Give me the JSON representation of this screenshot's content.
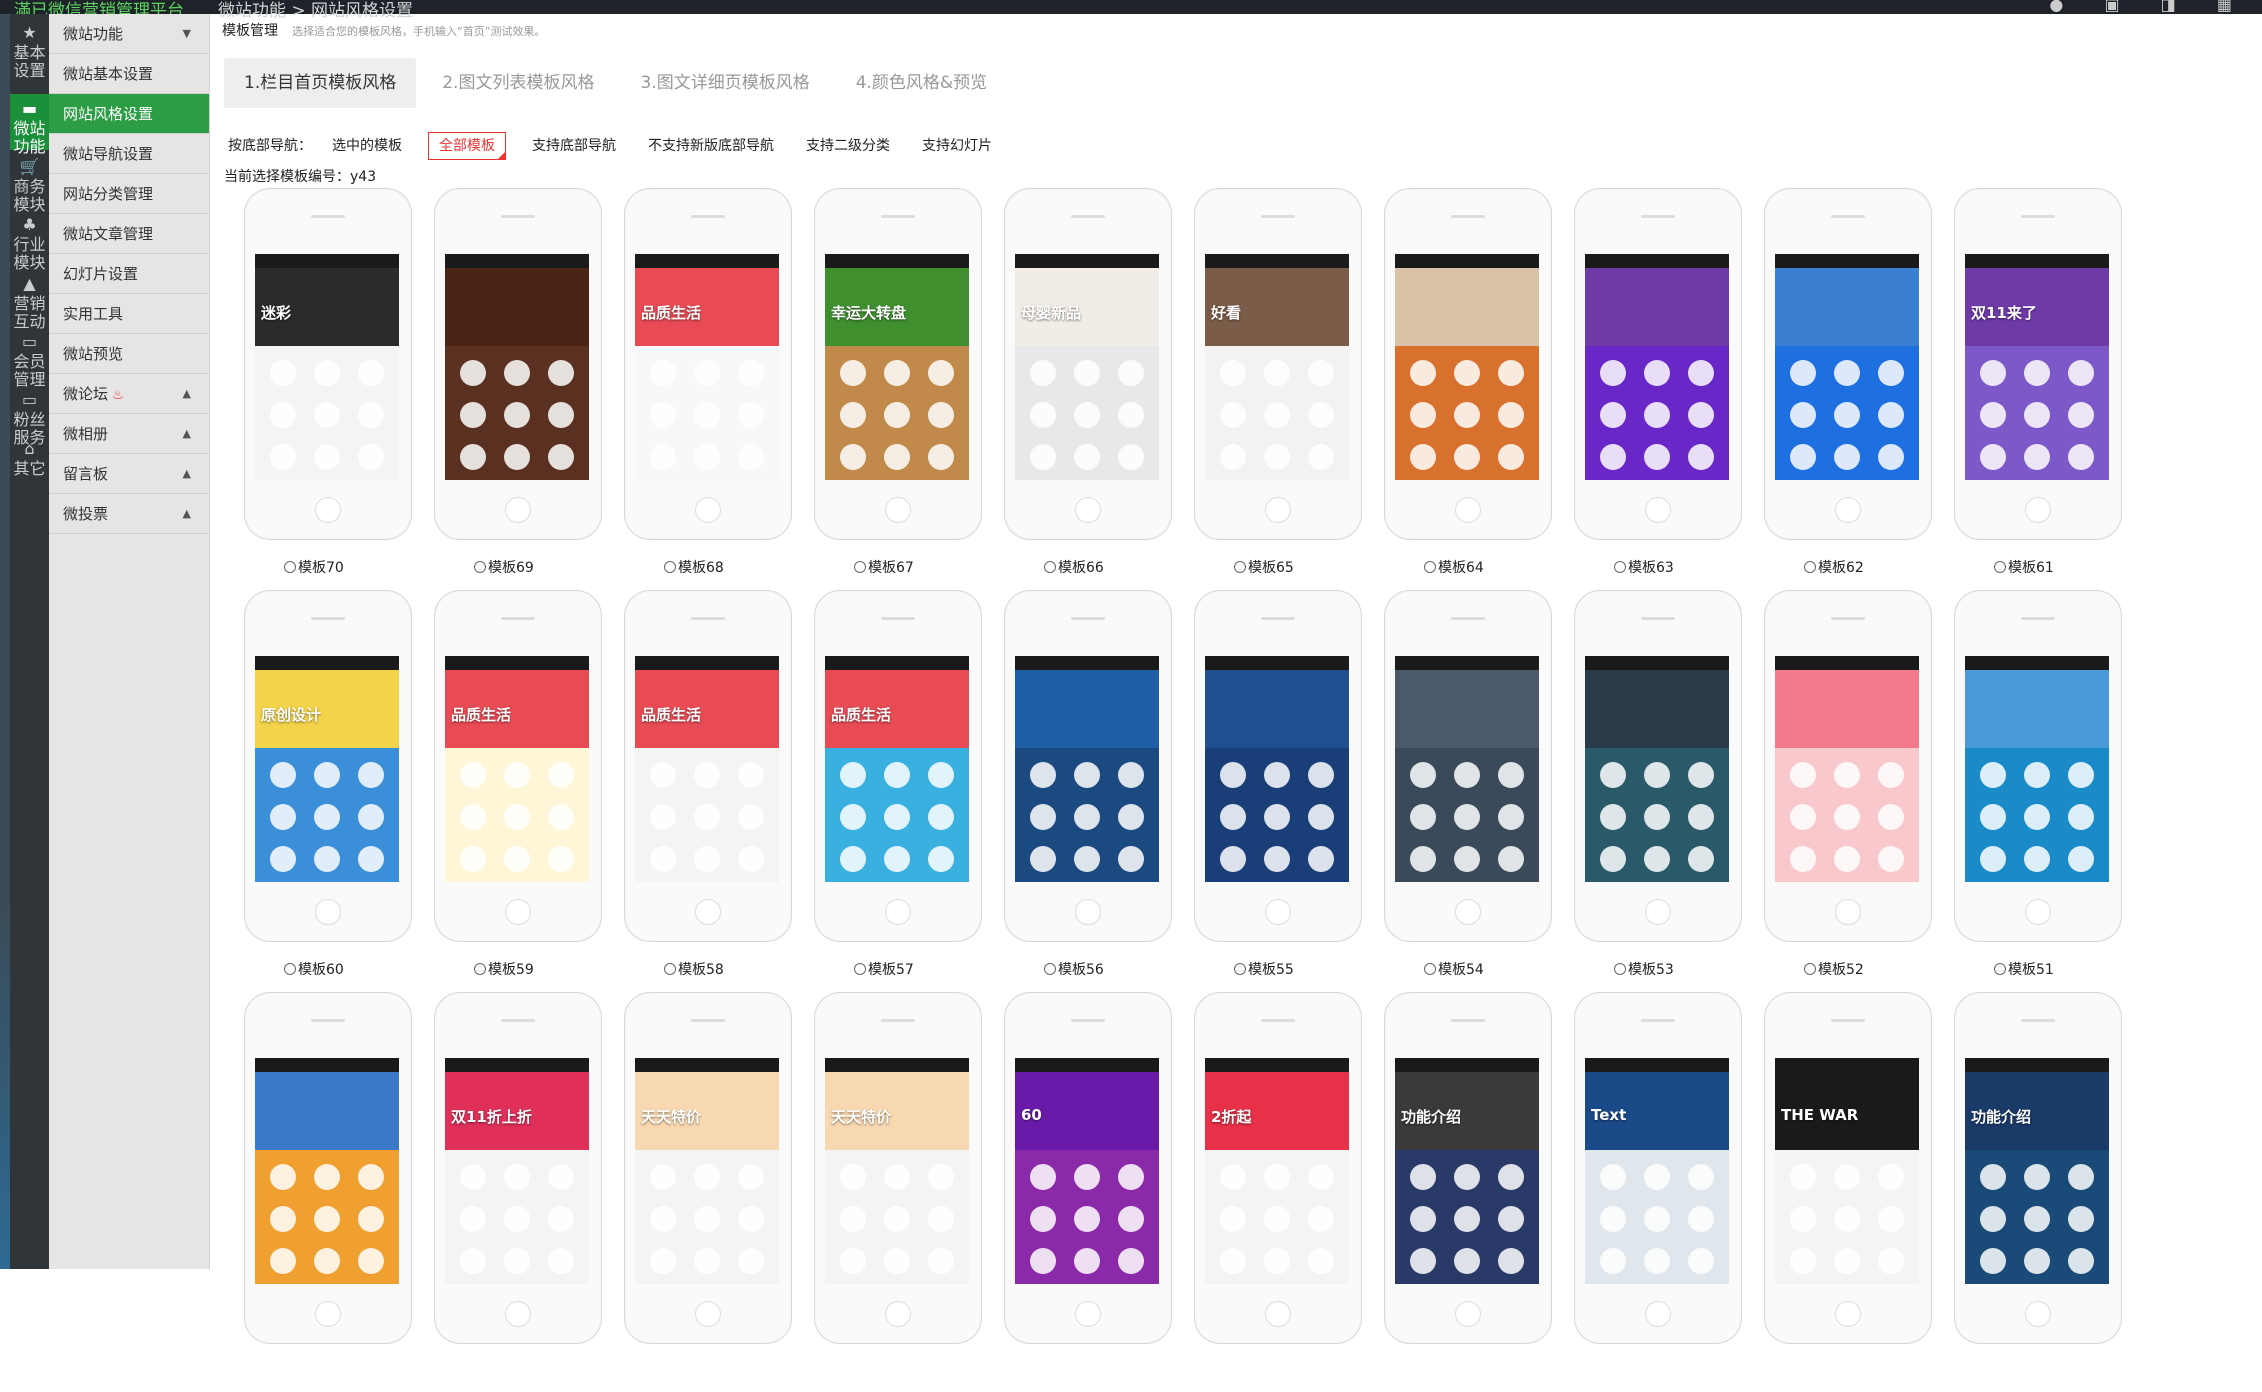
{
  "topbar": {
    "brand": "滿已微信营销管理平台",
    "crumb": "微站功能 > 网站风格设置",
    "right_icons": "● ▣ ◨ ▦"
  },
  "iconbar": [
    {
      "name": "基本设置",
      "icon": "★"
    },
    {
      "name": "微站功能",
      "icon": "▬",
      "active": true
    },
    {
      "name": "商务模块",
      "icon": "🛒"
    },
    {
      "name": "行业模块",
      "icon": "♣"
    },
    {
      "name": "营销互动",
      "icon": "▲"
    },
    {
      "name": "会员管理",
      "icon": "▭"
    },
    {
      "name": "粉丝服务",
      "icon": "▭"
    },
    {
      "name": "其它",
      "icon": "⌂"
    }
  ],
  "menu": [
    {
      "label": "微站功能",
      "arrow": "▼"
    },
    {
      "label": "微站基本设置"
    },
    {
      "label": "网站风格设置",
      "active": true
    },
    {
      "label": "微站导航设置"
    },
    {
      "label": "网站分类管理"
    },
    {
      "label": "微站文章管理"
    },
    {
      "label": "幻灯片设置"
    },
    {
      "label": "实用工具"
    },
    {
      "label": "微站预览"
    },
    {
      "label": "微论坛",
      "arrow": "▲",
      "hot": true
    },
    {
      "label": "微相册",
      "arrow": "▲"
    },
    {
      "label": "留言板",
      "arrow": "▲"
    },
    {
      "label": "微投票",
      "arrow": "▲"
    }
  ],
  "page": {
    "title": "模板管理",
    "hint": "选择适合您的模板风格，手机输入“首页”测试效果。"
  },
  "tabs": [
    "1.栏目首页模板风格",
    "2.图文列表模板风格",
    "3.图文详细页模板风格",
    "4.颜色风格&预览"
  ],
  "filters": {
    "label": "按底部导航：",
    "options": [
      "选中的模板",
      "全部模板",
      "支持底部导航",
      "不支持新版底部导航",
      "支持二级分类",
      "支持幻灯片"
    ],
    "selected": 1
  },
  "current": "当前选择模板编号：y43",
  "templates": [
    {
      "label": "模板70",
      "banner": "#2b2b2b",
      "body": "#f4f4f4",
      "btxt": "迷彩"
    },
    {
      "label": "模板69",
      "banner": "#4a2414",
      "body": "#5a3020",
      "btxt": ""
    },
    {
      "label": "模板68",
      "banner": "#e94b55",
      "body": "#f8f8f8",
      "btxt": "品质生活"
    },
    {
      "label": "模板67",
      "banner": "#3f8f2f",
      "body": "#c28a4a",
      "btxt": "幸运大转盘"
    },
    {
      "label": "模板66",
      "banner": "#f2ece6",
      "body": "#e8e8e8",
      "btxt": "母婴新品"
    },
    {
      "label": "模板65",
      "banner": "#7a5c48",
      "body": "#f2f2f2",
      "btxt": "好看"
    },
    {
      "label": "模板64",
      "banner": "#d9c2a8",
      "body": "#d8702e",
      "btxt": ""
    },
    {
      "label": "模板63",
      "banner": "#6e3aa8",
      "body": "#6a27c8",
      "btxt": ""
    },
    {
      "label": "模板62",
      "banner": "#3a7fd0",
      "body": "#1e6fe0",
      "btxt": ""
    },
    {
      "label": "模板61",
      "banner": "#6e3aa8",
      "body": "#7d58c8",
      "btxt": "双11来了"
    },
    {
      "label": "模板60",
      "banner": "#f3d34a",
      "body": "#3a8fd8",
      "btxt": "原创设计"
    },
    {
      "label": "模板59",
      "banner": "#e94b55",
      "body": "#fff6d8",
      "btxt": "品质生活"
    },
    {
      "label": "模板58",
      "banner": "#e94b55",
      "body": "#f4f4f4",
      "btxt": "品质生活"
    },
    {
      "label": "模板57",
      "banner": "#e94b55",
      "body": "#3ab0e0",
      "btxt": "品质生活"
    },
    {
      "label": "模板56",
      "banner": "#1e5fa8",
      "body": "#1b4a80",
      "btxt": ""
    },
    {
      "label": "模板55",
      "banner": "#1f4f8f",
      "body": "#1a3f78",
      "btxt": ""
    },
    {
      "label": "模板54",
      "banner": "#4a5a6a",
      "body": "#3a4a5a",
      "btxt": ""
    },
    {
      "label": "模板53",
      "banner": "#2a3a48",
      "body": "#2a5a6a",
      "btxt": ""
    },
    {
      "label": "模板52",
      "banner": "#f27a8a",
      "body": "#f8c8cc",
      "btxt": ""
    },
    {
      "label": "模板51",
      "banner": "#4a9ad8",
      "body": "#1a8ac8",
      "btxt": ""
    },
    {
      "label": "",
      "banner": "#3a78c8",
      "body": "#f0a030",
      "btxt": ""
    },
    {
      "label": "",
      "banner": "#e0305a",
      "body": "#f4f4f4",
      "btxt": "双11折上折"
    },
    {
      "label": "",
      "banner": "#f8d8b0",
      "body": "#f4f4f4",
      "btxt": "天天特价"
    },
    {
      "label": "",
      "banner": "#f8d8b0",
      "body": "#f4f4f4",
      "btxt": "天天特价"
    },
    {
      "label": "",
      "banner": "#6a1aa8",
      "body": "#8a2aa8",
      "btxt": "60"
    },
    {
      "label": "",
      "banner": "#e83048",
      "body": "#f4f4f4",
      "btxt": "2折起"
    },
    {
      "label": "",
      "banner": "#3a3a3a",
      "body": "#2a3a68",
      "btxt": "功能介绍"
    },
    {
      "label": "",
      "banner": "#1a4a88",
      "body": "#dfe6ec",
      "btxt": "Text"
    },
    {
      "label": "",
      "banner": "#1a1a1a",
      "body": "#f4f4f4",
      "btxt": "THE WAR"
    },
    {
      "label": "",
      "banner": "#1a3a68",
      "body": "#1a4a78",
      "btxt": "功能介绍"
    }
  ]
}
